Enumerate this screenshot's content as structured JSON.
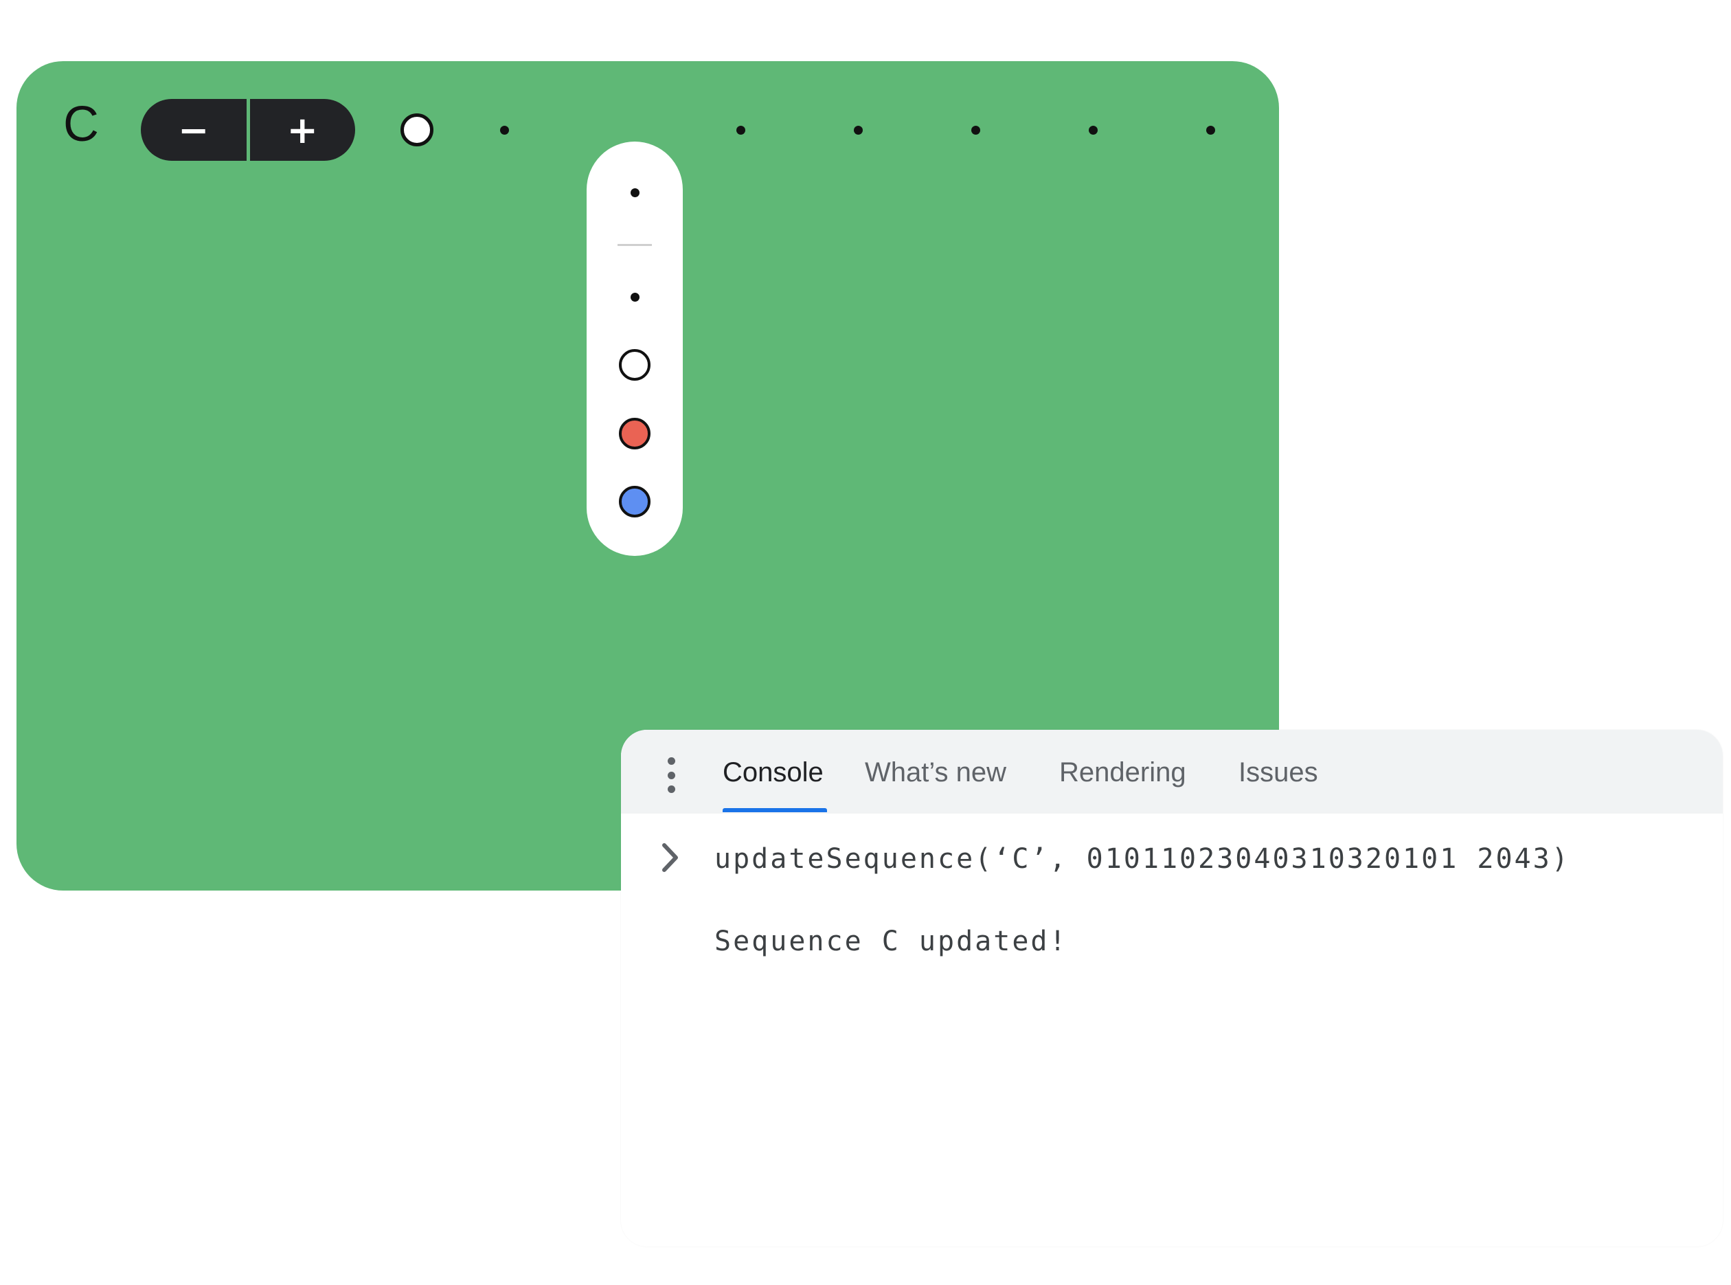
{
  "sequencer": {
    "label": "C",
    "background_color": "#5fb876",
    "stepper": {
      "minus_label": "−",
      "plus_label": "+"
    },
    "steps": [
      "ring-white",
      "dot",
      "dot",
      "dot",
      "dot",
      "dot",
      "dot",
      "dot"
    ],
    "picker": {
      "options": [
        "dot",
        "rest",
        "dot",
        "white",
        "red",
        "blue"
      ],
      "colors": {
        "white": "#ffffff",
        "red": "#ea6354",
        "blue": "#5e8ff2"
      }
    }
  },
  "devtools": {
    "tabs": [
      {
        "label": "Console",
        "active": true
      },
      {
        "label": "What’s new",
        "active": false
      },
      {
        "label": "Rendering",
        "active": false
      },
      {
        "label": "Issues",
        "active": false
      }
    ],
    "accent_color": "#1a73e8",
    "console": {
      "command": "updateSequence(‘C’, 01011023040310320101 2043)",
      "output": "Sequence C updated!"
    }
  }
}
